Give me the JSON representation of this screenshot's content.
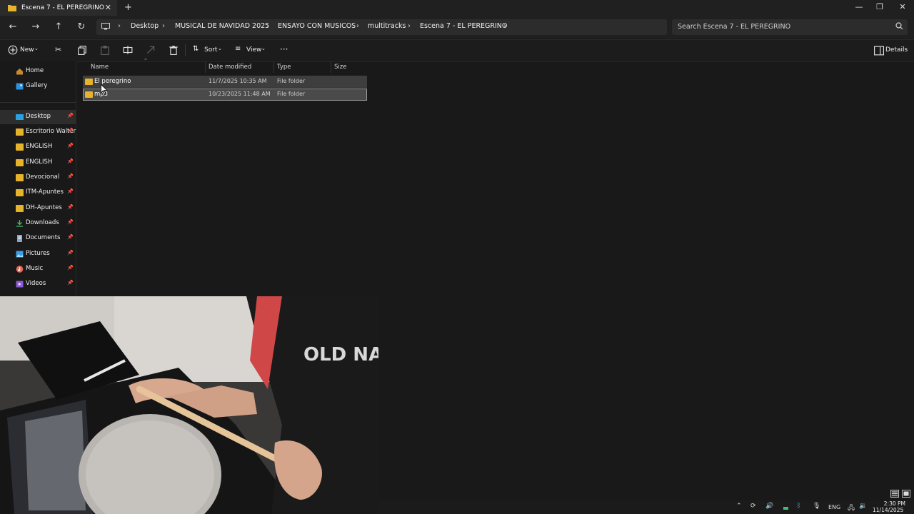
{
  "window": {
    "tab_title": "Escena 7 - EL PEREGRINO",
    "new_tab": "+",
    "controls": [
      "minimize",
      "maximize",
      "close"
    ]
  },
  "address": {
    "breadcrumbs": [
      "Desktop",
      "MUSICAL DE NAVIDAD 2025",
      "ENSAYO CON MUSICOS",
      "multitracks",
      "Escena 7 - EL PEREGRINO"
    ],
    "search_placeholder": "Search Escena 7 - EL PEREGRINO"
  },
  "toolbar": {
    "new_label": "New",
    "sort_label": "Sort",
    "view_label": "View",
    "details_label": "Details"
  },
  "sidebar": {
    "top_items": [
      {
        "label": "Home",
        "icon": "home-icon"
      },
      {
        "label": "Gallery",
        "icon": "gallery-icon"
      }
    ],
    "pinned_items": [
      {
        "label": "Desktop",
        "icon": "desktop-icon",
        "selected": true
      },
      {
        "label": "Escritorio Walter",
        "icon": "folder-icon"
      },
      {
        "label": "ENGLISH",
        "icon": "folder-icon"
      },
      {
        "label": "ENGLISH",
        "icon": "folder-icon"
      },
      {
        "label": "Devocional",
        "icon": "folder-icon"
      },
      {
        "label": "ITM-Apuntes",
        "icon": "folder-icon"
      },
      {
        "label": "DH-Apuntes",
        "icon": "folder-icon"
      },
      {
        "label": "Downloads",
        "icon": "download-icon"
      },
      {
        "label": "Documents",
        "icon": "documents-icon"
      },
      {
        "label": "Pictures",
        "icon": "pictures-icon"
      },
      {
        "label": "Music",
        "icon": "music-icon"
      },
      {
        "label": "Videos",
        "icon": "videos-icon"
      }
    ]
  },
  "file_list": {
    "columns": [
      "Name",
      "Date modified",
      "Type",
      "Size"
    ],
    "rows": [
      {
        "name": "El peregrino",
        "date": "11/7/2025 10:35 AM",
        "type": "File folder",
        "size": "",
        "selected": false
      },
      {
        "name": "mp3",
        "date": "10/23/2025 11:48 AM",
        "type": "File folder",
        "size": "",
        "selected": true
      }
    ]
  },
  "taskbar": {
    "language": "ENG",
    "time": "2:30 PM",
    "date": "11/14/2025"
  },
  "colors": {
    "background": "#191919",
    "folder": "#e7b32a",
    "accent": "#4cc2ff",
    "selection": "#4a4a4a"
  }
}
